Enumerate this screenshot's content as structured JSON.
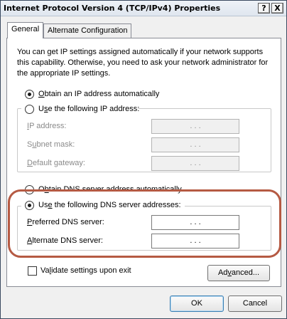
{
  "window": {
    "title": "Internet Protocol Version 4 (TCP/IPv4) Properties",
    "help_button": "?",
    "close_button": "X"
  },
  "tabs": [
    {
      "label": "General",
      "active": true
    },
    {
      "label": "Alternate Configuration",
      "active": false
    }
  ],
  "description": "You can get IP settings assigned automatically if your network supports this capability. Otherwise, you need to ask your network administrator for the appropriate IP settings.",
  "ip_section": {
    "auto_option": {
      "prefix": "",
      "accel": "O",
      "rest": "btain an IP address automatically",
      "selected": true
    },
    "manual_option": {
      "prefix": "U",
      "accel": "s",
      "rest": "e the following IP address:",
      "selected": false
    },
    "fields": [
      {
        "prefix": "",
        "accel": "I",
        "rest": "P address:",
        "value": ". . ."
      },
      {
        "prefix": "S",
        "accel": "u",
        "rest": "bnet mask:",
        "value": ". . ."
      },
      {
        "prefix": "",
        "accel": "D",
        "rest": "efault gateway:",
        "value": ". . ."
      }
    ]
  },
  "dns_section": {
    "auto_option": {
      "prefix": "O",
      "accel": "b",
      "rest": "tain DNS server address automatically",
      "selected": false
    },
    "manual_option": {
      "prefix": "Us",
      "accel": "e",
      "rest": " the following DNS server addresses:",
      "selected": true
    },
    "fields": [
      {
        "prefix": "",
        "accel": "P",
        "rest": "referred DNS server:",
        "value": ". . ."
      },
      {
        "prefix": "",
        "accel": "A",
        "rest": "lternate DNS server:",
        "value": ". . ."
      }
    ]
  },
  "validate": {
    "prefix": "Va",
    "accel": "l",
    "rest": "idate settings upon exit",
    "checked": false
  },
  "buttons": {
    "advanced": {
      "prefix": "Ad",
      "accel": "v",
      "rest": "anced..."
    },
    "ok": "OK",
    "cancel": "Cancel"
  },
  "colors": {
    "highlight_ring": "#b55a43",
    "disabled_text": "#8a8a8a"
  }
}
